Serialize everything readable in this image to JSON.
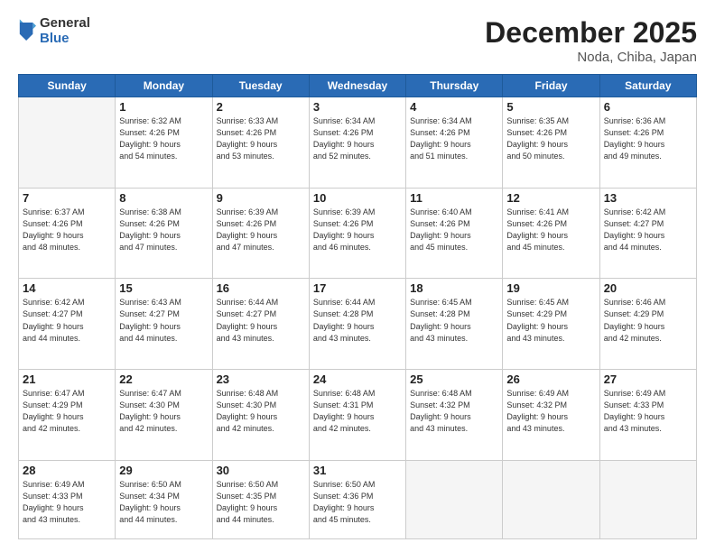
{
  "header": {
    "logo": {
      "general": "General",
      "blue": "Blue"
    },
    "title": "December 2025",
    "subtitle": "Noda, Chiba, Japan"
  },
  "weekdays": [
    "Sunday",
    "Monday",
    "Tuesday",
    "Wednesday",
    "Thursday",
    "Friday",
    "Saturday"
  ],
  "weeks": [
    [
      {
        "day": null
      },
      {
        "day": 1,
        "sunrise": "6:32 AM",
        "sunset": "4:26 PM",
        "daylight": "9 hours and 54 minutes."
      },
      {
        "day": 2,
        "sunrise": "6:33 AM",
        "sunset": "4:26 PM",
        "daylight": "9 hours and 53 minutes."
      },
      {
        "day": 3,
        "sunrise": "6:34 AM",
        "sunset": "4:26 PM",
        "daylight": "9 hours and 52 minutes."
      },
      {
        "day": 4,
        "sunrise": "6:34 AM",
        "sunset": "4:26 PM",
        "daylight": "9 hours and 51 minutes."
      },
      {
        "day": 5,
        "sunrise": "6:35 AM",
        "sunset": "4:26 PM",
        "daylight": "9 hours and 50 minutes."
      },
      {
        "day": 6,
        "sunrise": "6:36 AM",
        "sunset": "4:26 PM",
        "daylight": "9 hours and 49 minutes."
      }
    ],
    [
      {
        "day": 7,
        "sunrise": "6:37 AM",
        "sunset": "4:26 PM",
        "daylight": "9 hours and 48 minutes."
      },
      {
        "day": 8,
        "sunrise": "6:38 AM",
        "sunset": "4:26 PM",
        "daylight": "9 hours and 47 minutes."
      },
      {
        "day": 9,
        "sunrise": "6:39 AM",
        "sunset": "4:26 PM",
        "daylight": "9 hours and 47 minutes."
      },
      {
        "day": 10,
        "sunrise": "6:39 AM",
        "sunset": "4:26 PM",
        "daylight": "9 hours and 46 minutes."
      },
      {
        "day": 11,
        "sunrise": "6:40 AM",
        "sunset": "4:26 PM",
        "daylight": "9 hours and 45 minutes."
      },
      {
        "day": 12,
        "sunrise": "6:41 AM",
        "sunset": "4:26 PM",
        "daylight": "9 hours and 45 minutes."
      },
      {
        "day": 13,
        "sunrise": "6:42 AM",
        "sunset": "4:27 PM",
        "daylight": "9 hours and 44 minutes."
      }
    ],
    [
      {
        "day": 14,
        "sunrise": "6:42 AM",
        "sunset": "4:27 PM",
        "daylight": "9 hours and 44 minutes."
      },
      {
        "day": 15,
        "sunrise": "6:43 AM",
        "sunset": "4:27 PM",
        "daylight": "9 hours and 44 minutes."
      },
      {
        "day": 16,
        "sunrise": "6:44 AM",
        "sunset": "4:27 PM",
        "daylight": "9 hours and 43 minutes."
      },
      {
        "day": 17,
        "sunrise": "6:44 AM",
        "sunset": "4:28 PM",
        "daylight": "9 hours and 43 minutes."
      },
      {
        "day": 18,
        "sunrise": "6:45 AM",
        "sunset": "4:28 PM",
        "daylight": "9 hours and 43 minutes."
      },
      {
        "day": 19,
        "sunrise": "6:45 AM",
        "sunset": "4:29 PM",
        "daylight": "9 hours and 43 minutes."
      },
      {
        "day": 20,
        "sunrise": "6:46 AM",
        "sunset": "4:29 PM",
        "daylight": "9 hours and 42 minutes."
      }
    ],
    [
      {
        "day": 21,
        "sunrise": "6:47 AM",
        "sunset": "4:29 PM",
        "daylight": "9 hours and 42 minutes."
      },
      {
        "day": 22,
        "sunrise": "6:47 AM",
        "sunset": "4:30 PM",
        "daylight": "9 hours and 42 minutes."
      },
      {
        "day": 23,
        "sunrise": "6:48 AM",
        "sunset": "4:30 PM",
        "daylight": "9 hours and 42 minutes."
      },
      {
        "day": 24,
        "sunrise": "6:48 AM",
        "sunset": "4:31 PM",
        "daylight": "9 hours and 42 minutes."
      },
      {
        "day": 25,
        "sunrise": "6:48 AM",
        "sunset": "4:32 PM",
        "daylight": "9 hours and 43 minutes."
      },
      {
        "day": 26,
        "sunrise": "6:49 AM",
        "sunset": "4:32 PM",
        "daylight": "9 hours and 43 minutes."
      },
      {
        "day": 27,
        "sunrise": "6:49 AM",
        "sunset": "4:33 PM",
        "daylight": "9 hours and 43 minutes."
      }
    ],
    [
      {
        "day": 28,
        "sunrise": "6:49 AM",
        "sunset": "4:33 PM",
        "daylight": "9 hours and 43 minutes."
      },
      {
        "day": 29,
        "sunrise": "6:50 AM",
        "sunset": "4:34 PM",
        "daylight": "9 hours and 44 minutes."
      },
      {
        "day": 30,
        "sunrise": "6:50 AM",
        "sunset": "4:35 PM",
        "daylight": "9 hours and 44 minutes."
      },
      {
        "day": 31,
        "sunrise": "6:50 AM",
        "sunset": "4:36 PM",
        "daylight": "9 hours and 45 minutes."
      },
      {
        "day": null
      },
      {
        "day": null
      },
      {
        "day": null
      }
    ]
  ]
}
